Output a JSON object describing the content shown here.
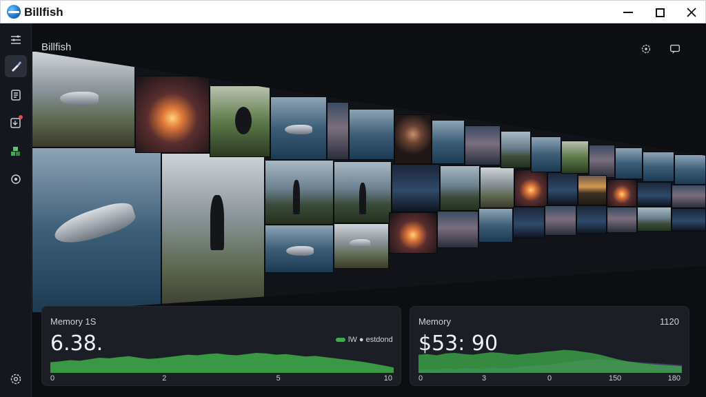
{
  "window": {
    "title": "Billfish",
    "controls": [
      "minimize",
      "maximize",
      "close"
    ]
  },
  "sidebar": {
    "items": [
      {
        "icon": "menu-icon",
        "active": false,
        "badge": false
      },
      {
        "icon": "brush-icon",
        "active": true,
        "badge": false
      },
      {
        "icon": "document-list-icon",
        "active": false,
        "badge": false
      },
      {
        "icon": "import-icon",
        "active": false,
        "badge": true
      },
      {
        "icon": "plugin-icon",
        "active": false,
        "badge": false
      },
      {
        "icon": "settings-icon",
        "active": false,
        "badge": false
      }
    ],
    "bottom_icon": "settings-icon"
  },
  "main": {
    "title": "Billfish",
    "actions": [
      "settings-icon",
      "feedback-icon"
    ]
  },
  "panels": {
    "left": {
      "label": "Memory 1S",
      "value": "6.38.",
      "legend": "lW ● estdond",
      "axis": [
        "0",
        "2",
        "5",
        "10"
      ],
      "series": [
        0.35,
        0.38,
        0.42,
        0.4,
        0.45,
        0.5,
        0.48,
        0.52,
        0.55,
        0.5,
        0.46,
        0.48,
        0.52,
        0.56,
        0.6,
        0.58,
        0.62,
        0.64,
        0.6,
        0.58,
        0.62,
        0.66,
        0.64,
        0.6,
        0.62,
        0.58,
        0.54,
        0.56,
        0.52,
        0.48,
        0.44,
        0.4,
        0.36,
        0.3,
        0.24,
        0.18
      ]
    },
    "right": {
      "label": "Memory",
      "corner": "1120",
      "value": "$53: 90",
      "axis": [
        "0",
        "3",
        "0",
        "150",
        "180"
      ],
      "series": [
        0.6,
        0.62,
        0.58,
        0.64,
        0.66,
        0.62,
        0.6,
        0.64,
        0.68,
        0.66,
        0.62,
        0.6,
        0.64,
        0.66,
        0.7,
        0.72,
        0.76,
        0.74,
        0.7,
        0.66,
        0.6,
        0.52,
        0.44,
        0.38,
        0.34,
        0.3,
        0.28,
        0.26,
        0.24,
        0.22
      ],
      "series2": [
        0.1,
        0.12,
        0.1,
        0.14,
        0.12,
        0.16,
        0.14,
        0.12,
        0.18,
        0.16,
        0.14,
        0.2,
        0.22,
        0.24,
        0.26,
        0.3,
        0.34,
        0.38,
        0.42,
        0.44,
        0.46,
        0.42,
        0.4,
        0.38,
        0.36,
        0.34,
        0.32,
        0.3,
        0.28,
        0.26
      ]
    }
  },
  "colors": {
    "accent_green": "#3fae4a",
    "accent_purple": "#4a3f7a",
    "notification_red": "#e74c4c"
  }
}
